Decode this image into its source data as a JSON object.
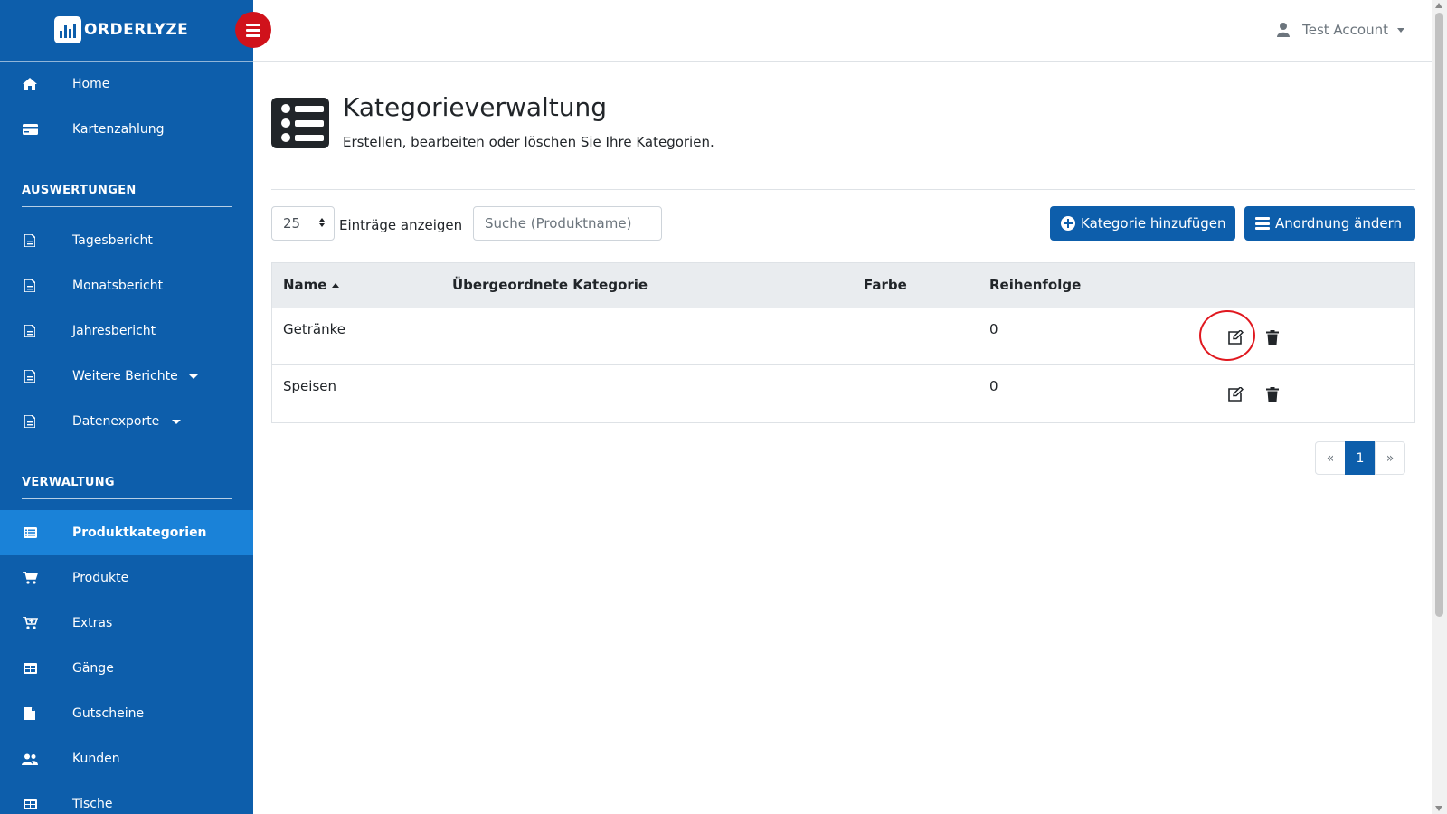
{
  "brand": {
    "name": "ORDERLYZE"
  },
  "header": {
    "account_name": "Test Account"
  },
  "sidebar": {
    "top_items": [
      {
        "label": "Home",
        "icon": "home-icon"
      },
      {
        "label": "Kartenzahlung",
        "icon": "credit-card-icon"
      }
    ],
    "section_reports": {
      "title": "AUSWERTUNGEN",
      "items": [
        {
          "label": "Tagesbericht",
          "icon": "file-icon"
        },
        {
          "label": "Monatsbericht",
          "icon": "file-icon"
        },
        {
          "label": "Jahresbericht",
          "icon": "file-icon"
        },
        {
          "label": "Weitere Berichte",
          "icon": "file-icon"
        },
        {
          "label": "Datenexporte",
          "icon": "file-icon"
        }
      ]
    },
    "section_admin": {
      "title": "VERWALTUNG",
      "items": [
        {
          "label": "Produktkategorien",
          "icon": "list-icon",
          "active": true
        },
        {
          "label": "Produkte",
          "icon": "cart-icon"
        },
        {
          "label": "Extras",
          "icon": "cart-plus-icon"
        },
        {
          "label": "Gänge",
          "icon": "table-icon"
        },
        {
          "label": "Gutscheine",
          "icon": "document-icon"
        },
        {
          "label": "Kunden",
          "icon": "users-icon"
        },
        {
          "label": "Tische",
          "icon": "table-icon"
        }
      ]
    }
  },
  "page": {
    "title": "Kategorieverwaltung",
    "subtitle": "Erstellen, bearbeiten oder löschen Sie Ihre Kategorien."
  },
  "toolbar": {
    "page_length": "25",
    "page_length_label": "Einträge anzeigen",
    "search_placeholder": "Suche (Produktname)",
    "add_label": "Kategorie hinzufügen",
    "order_label": "Anordnung ändern"
  },
  "table": {
    "columns": [
      "Name",
      "Übergeordnete Kategorie",
      "Farbe",
      "Reihenfolge"
    ],
    "rows": [
      {
        "name": "Getränke",
        "parent": "",
        "color": "",
        "order": "0"
      },
      {
        "name": "Speisen",
        "parent": "",
        "color": "",
        "order": "0"
      }
    ]
  },
  "pagination": {
    "prev": "«",
    "current": "1",
    "next": "»"
  },
  "colors": {
    "primary": "#0d5eab",
    "active_nav": "#1a82d8",
    "toggle": "#d0121b",
    "highlight": "#e0181f"
  }
}
